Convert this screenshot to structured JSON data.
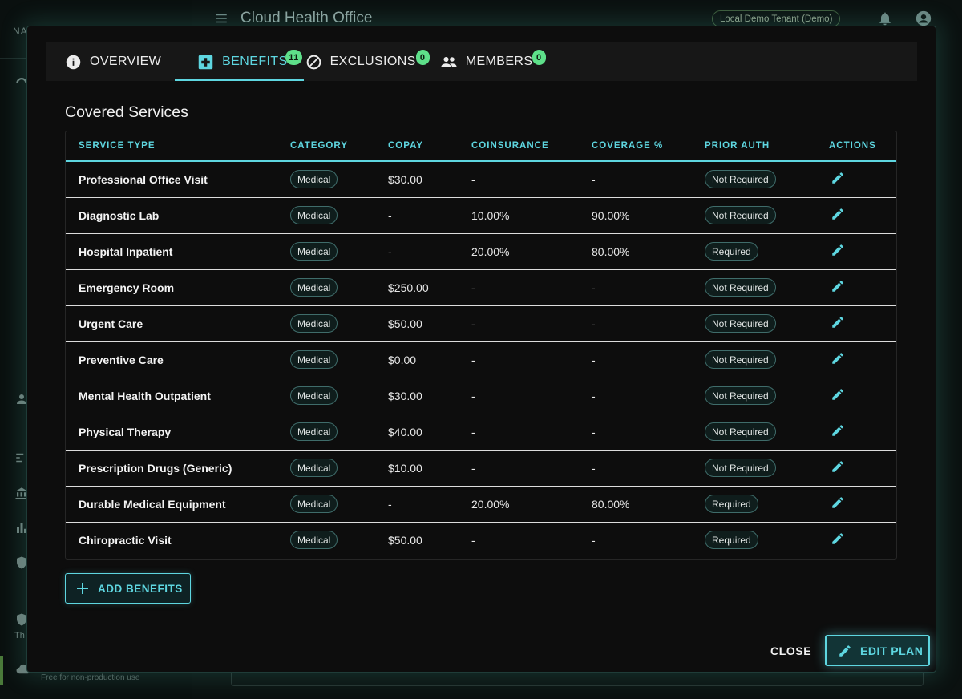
{
  "background": {
    "app_title": "Cloud Health Office",
    "nav_label": "NA",
    "tenant": "Local Demo Tenant (Demo)",
    "sidebar_footer_text": "Th",
    "footer_note": "Free for non-production use"
  },
  "tabs": [
    {
      "label": "OVERVIEW",
      "icon": "info-icon",
      "badge": null,
      "active": false
    },
    {
      "label": "BENEFITS",
      "icon": "medical-plus-icon",
      "badge": "11",
      "active": true
    },
    {
      "label": "EXCLUSIONS",
      "icon": "block-icon",
      "badge": "0",
      "active": false
    },
    {
      "label": "MEMBERS",
      "icon": "people-icon",
      "badge": "0",
      "active": false
    }
  ],
  "section_title": "Covered Services",
  "table": {
    "columns": [
      "SERVICE TYPE",
      "CATEGORY",
      "COPAY",
      "COINSURANCE",
      "COVERAGE %",
      "PRIOR AUTH",
      "ACTIONS"
    ],
    "rows": [
      {
        "service": "Professional Office Visit",
        "category": "Medical",
        "copay": "$30.00",
        "coinsurance": "-",
        "coverage": "-",
        "prior_auth": "Not Required"
      },
      {
        "service": "Diagnostic Lab",
        "category": "Medical",
        "copay": "-",
        "coinsurance": "10.00%",
        "coverage": "90.00%",
        "prior_auth": "Not Required"
      },
      {
        "service": "Hospital Inpatient",
        "category": "Medical",
        "copay": "-",
        "coinsurance": "20.00%",
        "coverage": "80.00%",
        "prior_auth": "Required"
      },
      {
        "service": "Emergency Room",
        "category": "Medical",
        "copay": "$250.00",
        "coinsurance": "-",
        "coverage": "-",
        "prior_auth": "Not Required"
      },
      {
        "service": "Urgent Care",
        "category": "Medical",
        "copay": "$50.00",
        "coinsurance": "-",
        "coverage": "-",
        "prior_auth": "Not Required"
      },
      {
        "service": "Preventive Care",
        "category": "Medical",
        "copay": "$0.00",
        "coinsurance": "-",
        "coverage": "-",
        "prior_auth": "Not Required"
      },
      {
        "service": "Mental Health Outpatient",
        "category": "Medical",
        "copay": "$30.00",
        "coinsurance": "-",
        "coverage": "-",
        "prior_auth": "Not Required"
      },
      {
        "service": "Physical Therapy",
        "category": "Medical",
        "copay": "$40.00",
        "coinsurance": "-",
        "coverage": "-",
        "prior_auth": "Not Required"
      },
      {
        "service": "Prescription Drugs (Generic)",
        "category": "Medical",
        "copay": "$10.00",
        "coinsurance": "-",
        "coverage": "-",
        "prior_auth": "Not Required"
      },
      {
        "service": "Durable Medical Equipment",
        "category": "Medical",
        "copay": "-",
        "coinsurance": "20.00%",
        "coverage": "80.00%",
        "prior_auth": "Required"
      },
      {
        "service": "Chiropractic Visit",
        "category": "Medical",
        "copay": "$50.00",
        "coinsurance": "-",
        "coverage": "-",
        "prior_auth": "Required"
      }
    ]
  },
  "actions": {
    "add_benefits": "ADD BENEFITS",
    "close": "CLOSE",
    "edit_plan": "EDIT PLAN"
  },
  "colors": {
    "accent": "#5ed6e0",
    "badge": "#5ee08a",
    "modal_bg": "#0d0d0d"
  }
}
